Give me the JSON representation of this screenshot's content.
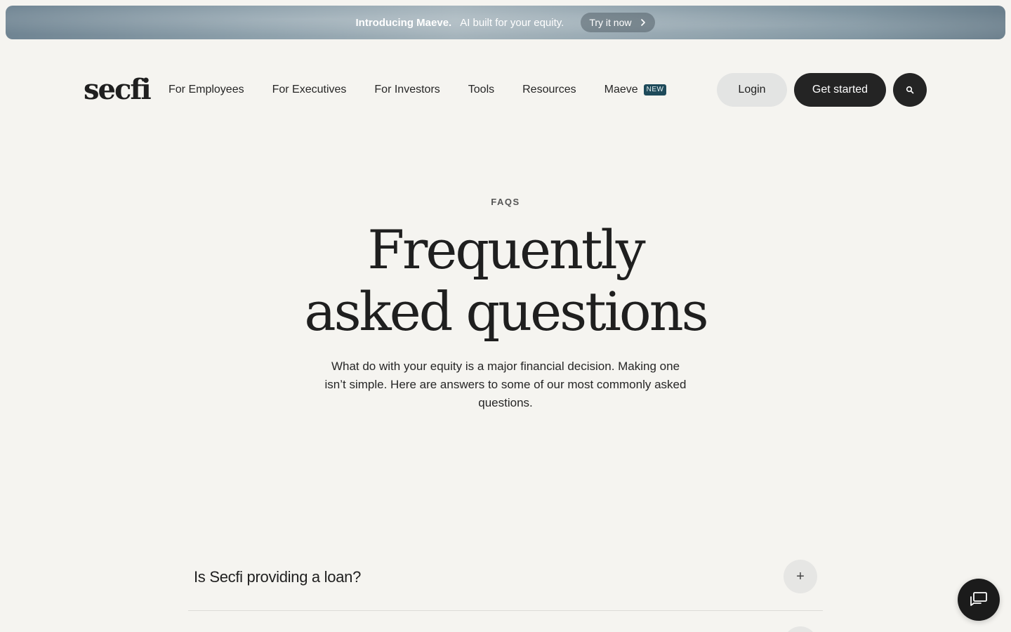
{
  "banner": {
    "strong": "Introducing Maeve.",
    "text": "AI built for your equity.",
    "cta": "Try it now"
  },
  "nav": {
    "logo": "secfi",
    "links": [
      "For Employees",
      "For Executives",
      "For Investors",
      "Tools",
      "Resources",
      "Maeve"
    ],
    "new_badge": "NEW",
    "login": "Login",
    "get_started": "Get started"
  },
  "hero": {
    "eyebrow": "FAQS",
    "title_line1": "Frequently",
    "title_line2": "asked questions",
    "subtext": "What do with your equity is a major financial decision. Making one isn’t simple. Here are answers to some of our most commonly asked questions."
  },
  "faq": {
    "items": [
      {
        "question": "Is Secfi providing a loan?",
        "toggle": "+"
      }
    ]
  },
  "colors": {
    "background": "#f5f4f0",
    "primary_dark": "#242424",
    "badge": "#1e4a5a"
  },
  "icons": {
    "cta": "chevron-right-icon",
    "search": "search-icon",
    "chat": "chat-icon"
  }
}
